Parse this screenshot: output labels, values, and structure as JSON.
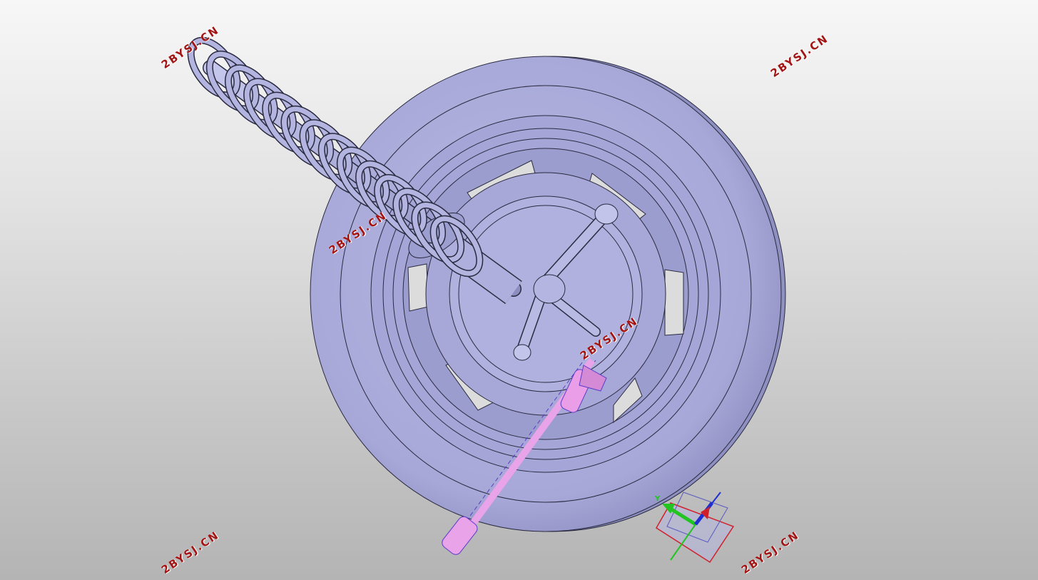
{
  "watermarks": [
    {
      "text": "2BYSJ.CN"
    },
    {
      "text": "2BYSJ.CN"
    },
    {
      "text": "2BYSJ.CN"
    },
    {
      "text": "2BYSJ.CN"
    },
    {
      "text": "2BYSJ.CN"
    },
    {
      "text": "2BYSJ.CN"
    }
  ],
  "triad": {
    "y_label": "Y"
  },
  "colors": {
    "model_fill": "#a9aad9",
    "model_shadow": "#8c8dbf",
    "model_highlight": "#c4c5ea",
    "edge": "#2a2a40",
    "selected_part": "#e9a3e8",
    "selected_edge": "#5a3cc8",
    "watermark": "#a31515",
    "triad_x": "#d0202a",
    "triad_y": "#22c422",
    "triad_z": "#2030d0"
  },
  "icons": [
    "wheel-model",
    "coil-spring",
    "shock-absorber",
    "selected-link-arm",
    "coordinate-triad"
  ]
}
